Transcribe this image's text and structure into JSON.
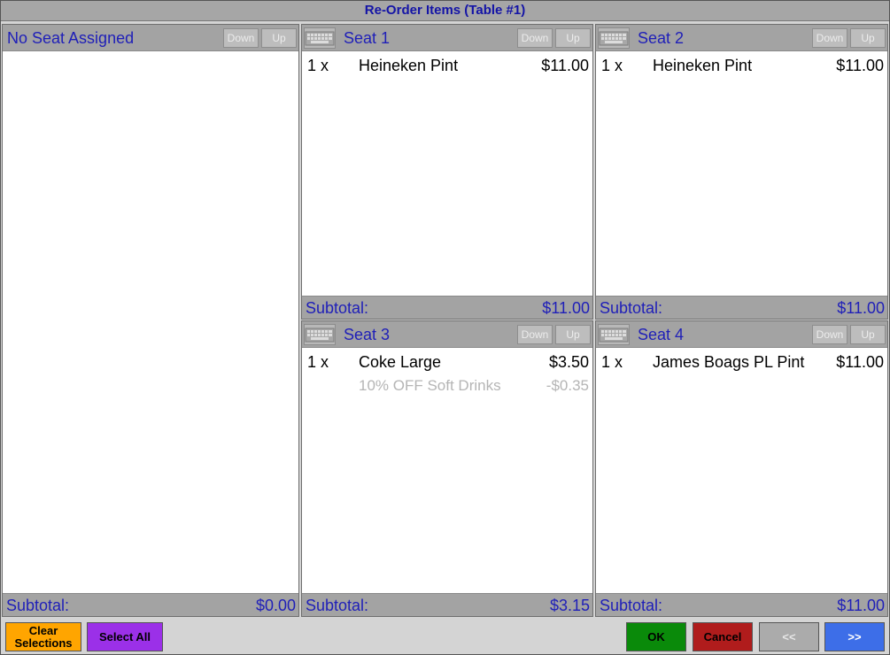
{
  "window": {
    "title": "Re-Order Items (Table #1)"
  },
  "panels": {
    "unassigned": {
      "title": "No Seat Assigned",
      "down_label": "Down",
      "up_label": "Up",
      "subtotal_label": "Subtotal:",
      "subtotal_value": "$0.00",
      "items": []
    },
    "seat1": {
      "title": "Seat 1",
      "down_label": "Down",
      "up_label": "Up",
      "subtotal_label": "Subtotal:",
      "subtotal_value": "$11.00",
      "items": [
        {
          "qty": "1 x",
          "name": "Heineken Pint",
          "price": "$11.00"
        }
      ]
    },
    "seat2": {
      "title": "Seat 2",
      "down_label": "Down",
      "up_label": "Up",
      "subtotal_label": "Subtotal:",
      "subtotal_value": "$11.00",
      "items": [
        {
          "qty": "1 x",
          "name": "Heineken Pint",
          "price": "$11.00"
        }
      ]
    },
    "seat3": {
      "title": "Seat 3",
      "down_label": "Down",
      "up_label": "Up",
      "subtotal_label": "Subtotal:",
      "subtotal_value": "$3.15",
      "items": [
        {
          "qty": "1 x",
          "name": "Coke Large",
          "price": "$3.50"
        },
        {
          "qty": "",
          "name": "10% OFF Soft Drinks",
          "price": "-$0.35"
        }
      ]
    },
    "seat4": {
      "title": "Seat 4",
      "down_label": "Down",
      "up_label": "Up",
      "subtotal_label": "Subtotal:",
      "subtotal_value": "$11.00",
      "items": [
        {
          "qty": "1 x",
          "name": "James Boags PL Pint",
          "price": "$11.00"
        }
      ]
    }
  },
  "buttons": {
    "clear_line1": "Clear",
    "clear_line2": "Selections",
    "select_all": "Select All",
    "ok": "OK",
    "cancel": "Cancel",
    "prev": "<<",
    "next": ">>"
  },
  "colors": {
    "title_text": "#1414a6",
    "header_text": "#1f1fb8",
    "header_bg": "#a3a3a3",
    "clear_bg": "#ffa500",
    "select_all_bg": "#9b30e8",
    "ok_bg": "#0a8a0a",
    "cancel_bg": "#b01c1c",
    "prev_bg": "#ababab",
    "next_bg": "#3d6ee8",
    "discount_text": "#b5b5b5"
  },
  "icons": {
    "seat_header_icon": "keyboard-icon"
  }
}
